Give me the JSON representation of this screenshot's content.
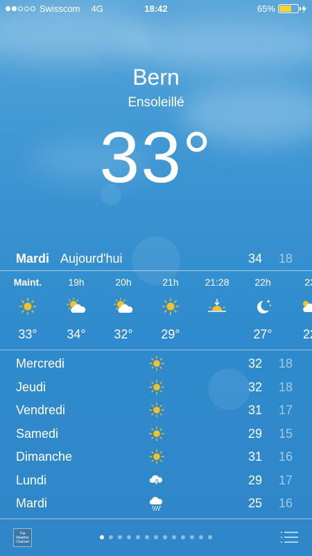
{
  "status_bar": {
    "carrier": "Swisscom",
    "network": "4G",
    "time": "18:42",
    "battery_percent": "65%",
    "battery_level": 0.65,
    "signal_bars": 2
  },
  "header": {
    "city": "Bern",
    "condition": "Ensoleillé",
    "temperature": "33°"
  },
  "today": {
    "day": "Mardi",
    "label": "Aujourd'hui",
    "high": "34",
    "low": "18"
  },
  "hourly": [
    {
      "time": "Maint.",
      "icon": "sun-icon",
      "temp": "33°"
    },
    {
      "time": "19h",
      "icon": "partly-cloudy-icon",
      "temp": "34°"
    },
    {
      "time": "20h",
      "icon": "partly-cloudy-icon",
      "temp": "32°"
    },
    {
      "time": "21h",
      "icon": "sun-icon",
      "temp": "29°"
    },
    {
      "time": "21:28",
      "icon": "sunset-icon",
      "temp": ""
    },
    {
      "time": "22h",
      "icon": "moon-stars-icon",
      "temp": "27°"
    },
    {
      "time": "23",
      "icon": "cloud-icon",
      "temp": "22"
    }
  ],
  "daily": [
    {
      "day": "Mercredi",
      "icon": "sun-icon",
      "high": "32",
      "low": "18"
    },
    {
      "day": "Jeudi",
      "icon": "sun-icon",
      "high": "32",
      "low": "18"
    },
    {
      "day": "Vendredi",
      "icon": "sun-icon",
      "high": "31",
      "low": "17"
    },
    {
      "day": "Samedi",
      "icon": "sun-icon",
      "high": "29",
      "low": "15"
    },
    {
      "day": "Dimanche",
      "icon": "sun-icon",
      "high": "31",
      "low": "16"
    },
    {
      "day": "Lundi",
      "icon": "thunderstorm-icon",
      "high": "29",
      "low": "17"
    },
    {
      "day": "Mardi",
      "icon": "rain-icon",
      "high": "25",
      "low": "16"
    }
  ],
  "footer": {
    "logo_text": "The Weather Channel",
    "page_count": 13,
    "active_page": 0
  },
  "colors": {
    "sun": "#f7c21f",
    "battery": "#f7d232",
    "sky": "#3f97d3"
  }
}
